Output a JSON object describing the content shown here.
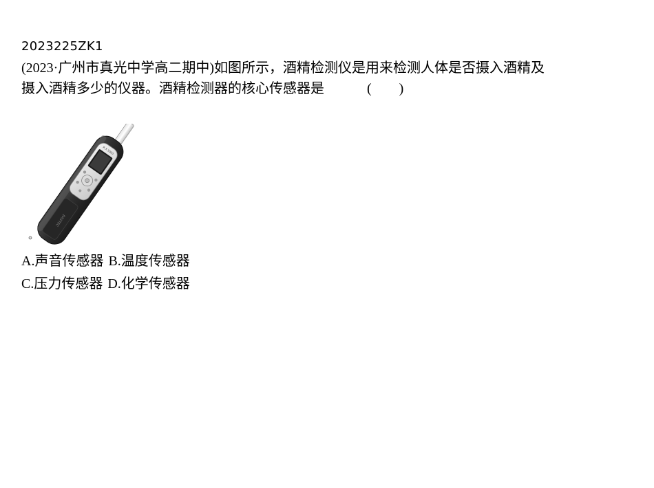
{
  "question": {
    "id": "2023225ZK1",
    "stem_line1": "(2023·广州市真光中学高二期中)如图所示，酒精检测仪是用来检测人体是否摄入酒精及",
    "stem_line2": "摄入酒精多少的仪器。酒精检测器的核心传感器是",
    "answer_blank": "(　　)"
  },
  "figure": {
    "device_label": "R X 3000",
    "brand_text": "JULYTEC"
  },
  "options": {
    "A": "A.声音传感器",
    "B": "B.温度传感器",
    "C": "C.压力传感器",
    "D": "D.化学传感器"
  }
}
